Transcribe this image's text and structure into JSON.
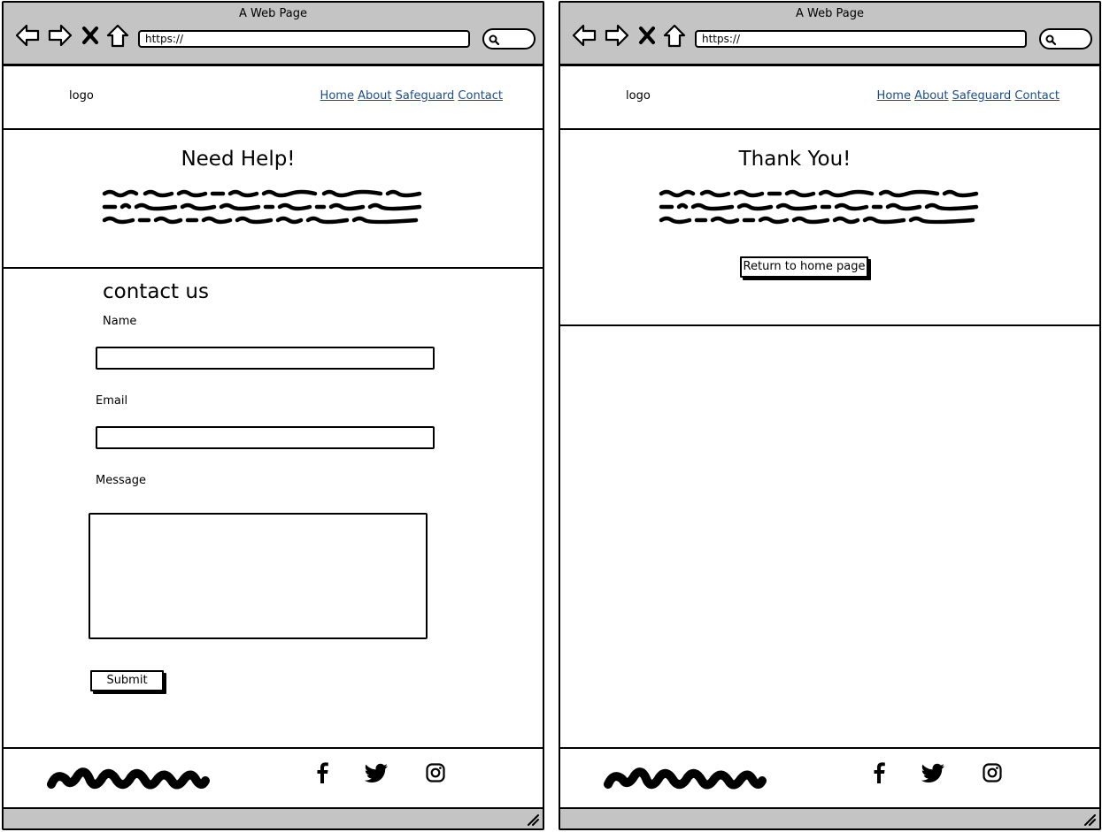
{
  "colors": {
    "chrome_bg": "#c4c4c4",
    "link": "#1a4f8c"
  },
  "contact_page": {
    "browser": {
      "title": "A Web Page",
      "url": "https://"
    },
    "header": {
      "logo": "logo",
      "nav": [
        "Home",
        "About",
        "Safeguard",
        "Contact"
      ]
    },
    "hero": {
      "title": "Need Help!"
    },
    "form": {
      "title": "contact us",
      "name_label": "Name",
      "email_label": "Email",
      "message_label": "Message",
      "submit_label": "Submit"
    },
    "footer": {
      "icons": [
        "facebook-icon",
        "twitter-icon",
        "instagram-icon"
      ]
    }
  },
  "thank_you_page": {
    "browser": {
      "title": "A Web Page",
      "url": "https://"
    },
    "header": {
      "logo": "logo",
      "nav": [
        "Home",
        "About",
        "Safeguard",
        "Contact"
      ]
    },
    "hero": {
      "title": "Thank You!",
      "button_label": "Return to home page"
    },
    "footer": {
      "icons": [
        "facebook-icon",
        "twitter-icon",
        "instagram-icon"
      ]
    }
  }
}
